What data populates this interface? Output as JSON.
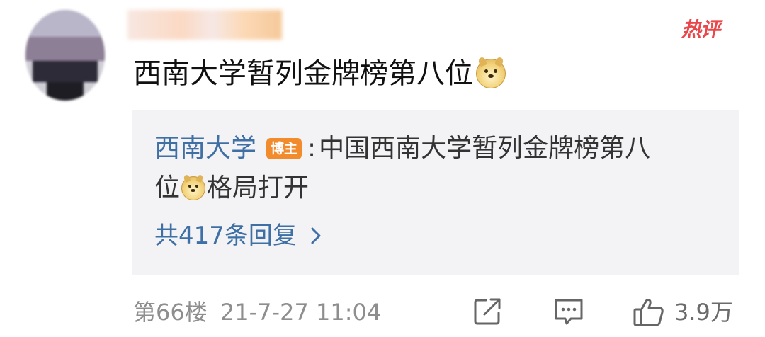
{
  "comment": {
    "username": "",
    "hot_label": "热评",
    "text": "西南大学暂列金牌榜第八位",
    "emoji": "doge-emoji"
  },
  "reply": {
    "author": "西南大学",
    "author_badge": "博主",
    "separator": ":",
    "text_line1": "中国西南大学暂列金牌榜第八",
    "text_line2_before": "位",
    "text_line2_after": "格局打开",
    "emoji": "doge-emoji",
    "count_label": "共417条回复"
  },
  "footer": {
    "floor": "第66楼",
    "timestamp": "21-7-27 11:04",
    "like_count": "3.9万",
    "icons": [
      "share-icon",
      "comment-icon",
      "like-icon"
    ]
  },
  "colors": {
    "link_blue": "#3e6fa5",
    "hot_red": "#e8484b",
    "badge_orange": "#f28b2c",
    "reply_bg": "#f3f3f5",
    "meta_gray": "#8e8e8e"
  }
}
